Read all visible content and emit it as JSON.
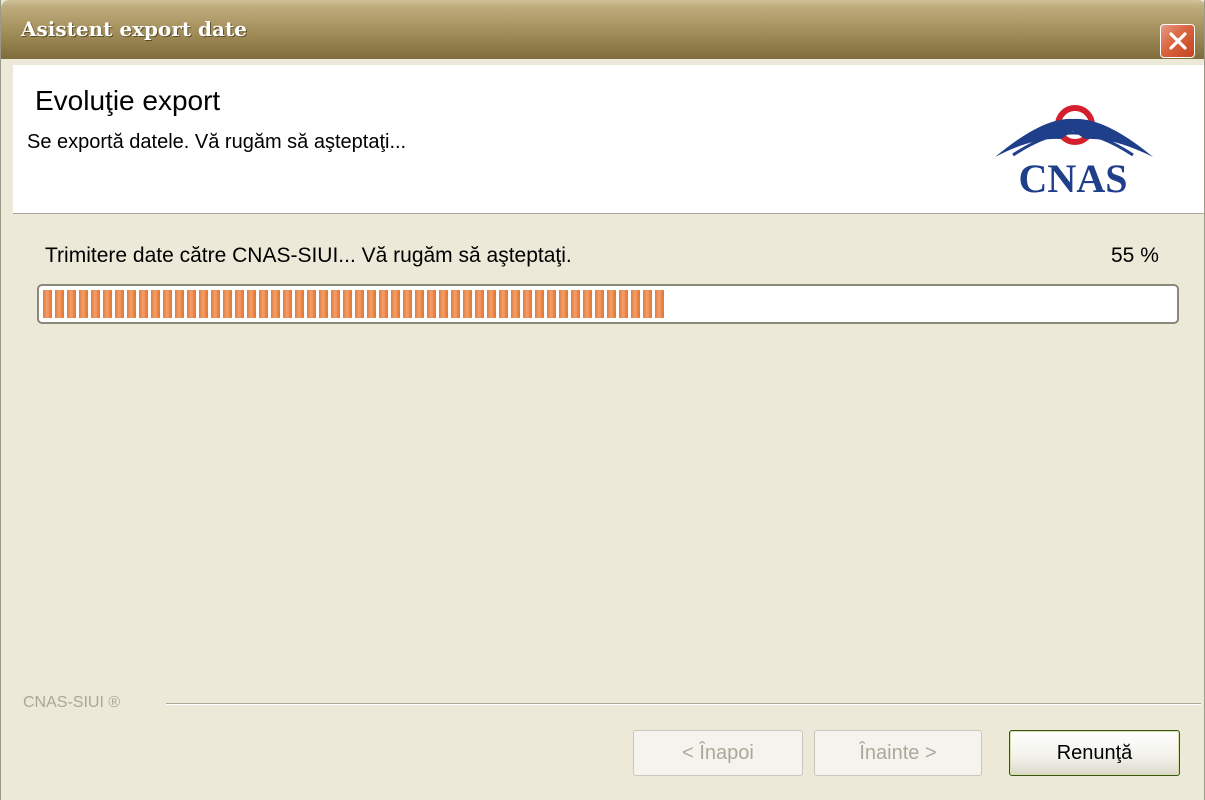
{
  "window": {
    "title": "Asistent export date"
  },
  "header": {
    "title": "Evoluţie export",
    "subtitle": "Se exportă datele. Vă rugăm să aşteptaţi...",
    "logo_text": "CNAS"
  },
  "progress": {
    "status_text": "Trimitere date către CNAS-SIUI... Vă rugăm să aşteptaţi.",
    "percent_label": "55 %",
    "value": 0.55,
    "fill_color": "#e57a3a"
  },
  "footer": {
    "brand": "CNAS-SIUI ®"
  },
  "buttons": {
    "back_label": "< Înapoi",
    "next_label": "Înainte >",
    "cancel_label": "Renunţă"
  },
  "colors": {
    "dialog_bg": "#ece9d8",
    "title_bar": "#a89460",
    "close_button": "#d9653f",
    "logo_blue": "#1f3f8a",
    "logo_red": "#d4202c"
  }
}
